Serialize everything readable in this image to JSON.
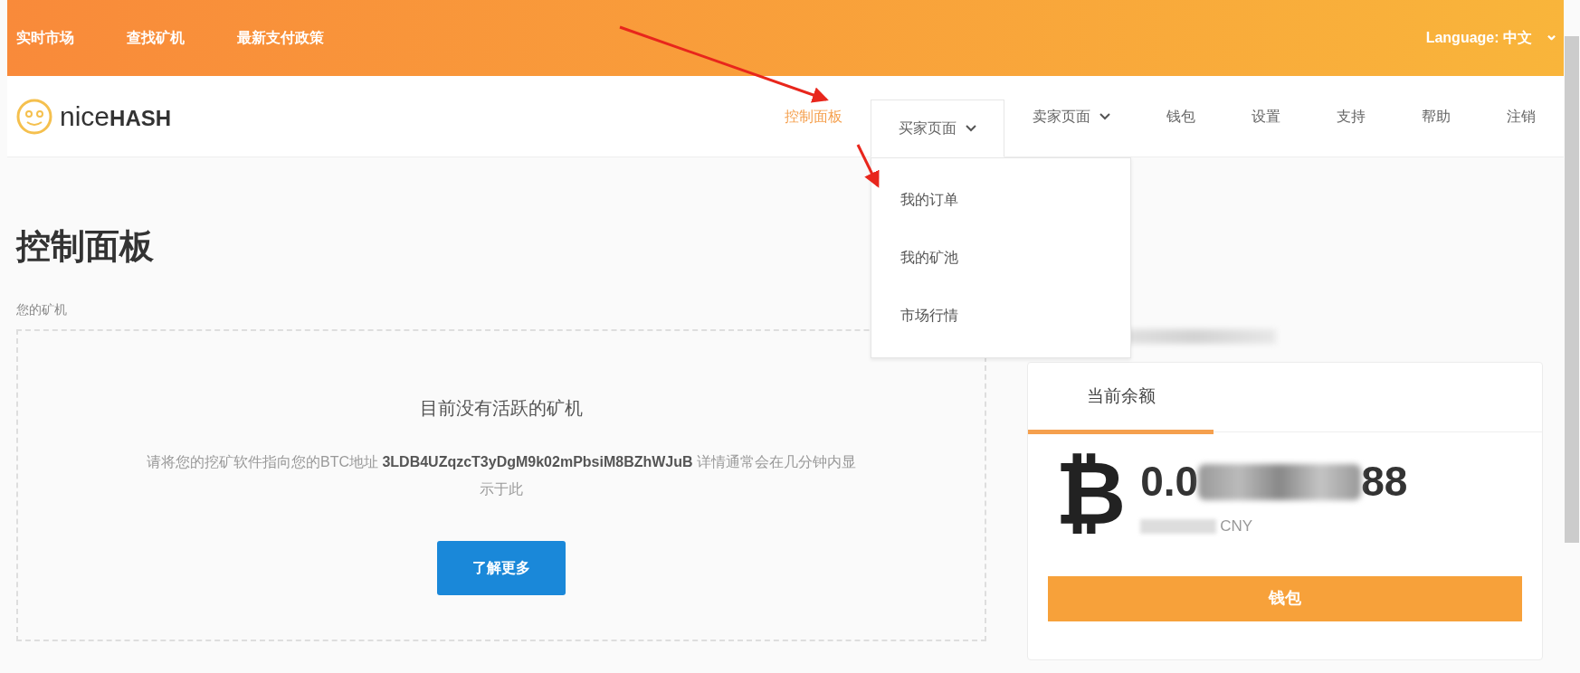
{
  "top_bar": {
    "links": [
      {
        "label": "实时市场"
      },
      {
        "label": "查找矿机"
      },
      {
        "label": "最新支付政策"
      }
    ],
    "language": {
      "label": "Language: 中文",
      "caret": "⌄"
    }
  },
  "brand": {
    "name_light": "nice",
    "name_bold": "HASH"
  },
  "nav": [
    {
      "label": "控制面板",
      "kind": "link",
      "selected": true,
      "expanded": false
    },
    {
      "label": "买家页面",
      "kind": "dropdown",
      "selected": false,
      "expanded": true,
      "menu": [
        "我的订单",
        "我的矿池",
        "市场行情"
      ]
    },
    {
      "label": "卖家页面",
      "kind": "dropdown",
      "selected": false,
      "expanded": false
    },
    {
      "label": "钱包",
      "kind": "link",
      "selected": false,
      "expanded": false
    },
    {
      "label": "设置",
      "kind": "link",
      "selected": false,
      "expanded": false
    },
    {
      "label": "支持",
      "kind": "link",
      "selected": false,
      "expanded": false
    },
    {
      "label": "帮助",
      "kind": "link",
      "selected": false,
      "expanded": false
    },
    {
      "label": "注销",
      "kind": "link",
      "selected": false,
      "expanded": false
    }
  ],
  "page": {
    "title": "控制面板",
    "section_label": "您的矿机"
  },
  "miners_panel": {
    "title": "目前没有活跃的矿机",
    "message": "请将您的挖矿软件指向您的BTC地址 **3LDB4UZqzcT3yDgM9k02mPbsiM8BZhWJuB** 详情通常会在几分钟内显示于此",
    "button": "了解更多"
  },
  "balance_card": {
    "tab": "当前余额",
    "currency_symbol": "₿",
    "amount_start": "0.0",
    "amount_end": "88",
    "fiat_unit": "CNY",
    "button": "钱包"
  }
}
